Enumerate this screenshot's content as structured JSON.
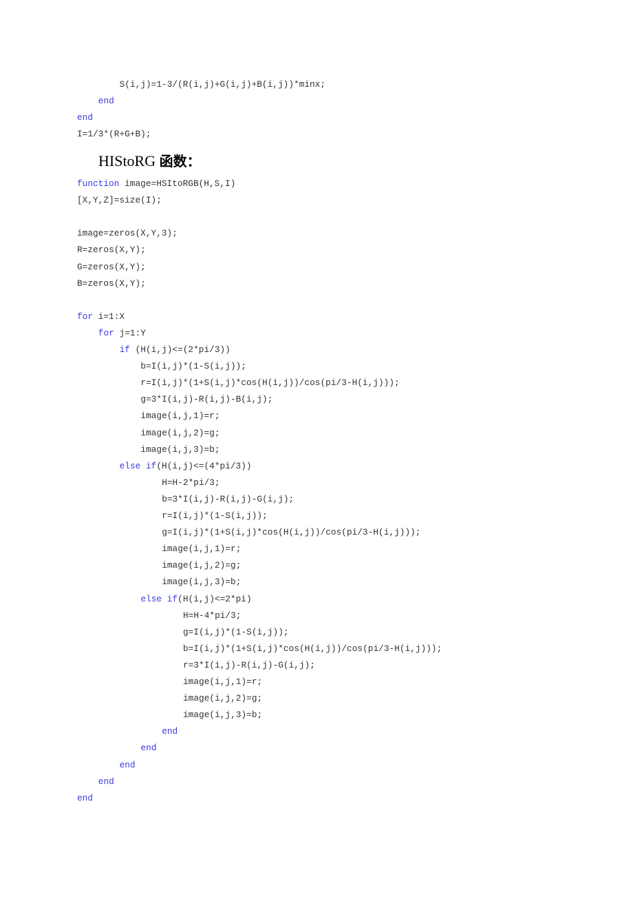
{
  "document": {
    "colors": {
      "keyword": "#3a3ae0",
      "code": "#333333",
      "heading": "#000000"
    },
    "pre_lines": [
      {
        "indent": 2,
        "kw": "",
        "text": "S(i,j)=1-3/(R(i,j)+G(i,j)+B(i,j))*minx;"
      },
      {
        "indent": 1,
        "kw": "end",
        "text": ""
      },
      {
        "indent": 0,
        "kw": "end",
        "text": ""
      },
      {
        "indent": 0,
        "kw": "",
        "text": "I=1/3*(R+G+B);"
      }
    ],
    "section_heading": {
      "latin": "HIStoRG",
      "cjk": "函数："
    },
    "code_lines": [
      {
        "indent": 0,
        "kw": "function",
        "text": " image=HSItoRGB(H,S,I)"
      },
      {
        "indent": 0,
        "kw": "",
        "text": "[X,Y,Z]=size(I);"
      },
      {
        "indent": 0,
        "kw": "",
        "text": ""
      },
      {
        "indent": 0,
        "kw": "",
        "text": "image=zeros(X,Y,3);"
      },
      {
        "indent": 0,
        "kw": "",
        "text": "R=zeros(X,Y);"
      },
      {
        "indent": 0,
        "kw": "",
        "text": "G=zeros(X,Y);"
      },
      {
        "indent": 0,
        "kw": "",
        "text": "B=zeros(X,Y);"
      },
      {
        "indent": 0,
        "kw": "",
        "text": ""
      },
      {
        "indent": 0,
        "kw": "for",
        "text": " i=1:X"
      },
      {
        "indent": 1,
        "kw": "for",
        "text": " j=1:Y"
      },
      {
        "indent": 2,
        "kw": "if",
        "text": " (H(i,j)<=(2*pi/3))"
      },
      {
        "indent": 3,
        "kw": "",
        "text": "b=I(i,j)*(1-S(i,j));"
      },
      {
        "indent": 3,
        "kw": "",
        "text": "r=I(i,j)*(1+S(i,j)*cos(H(i,j))/cos(pi/3-H(i,j)));"
      },
      {
        "indent": 3,
        "kw": "",
        "text": "g=3*I(i,j)-R(i,j)-B(i,j);"
      },
      {
        "indent": 3,
        "kw": "",
        "text": "image(i,j,1)=r;"
      },
      {
        "indent": 3,
        "kw": "",
        "text": "image(i,j,2)=g;"
      },
      {
        "indent": 3,
        "kw": "",
        "text": "image(i,j,3)=b;"
      },
      {
        "indent": 2,
        "kw": "else if",
        "text": "(H(i,j)<=(4*pi/3))"
      },
      {
        "indent": 4,
        "kw": "",
        "text": "H=H-2*pi/3;"
      },
      {
        "indent": 4,
        "kw": "",
        "text": "b=3*I(i,j)-R(i,j)-G(i,j);"
      },
      {
        "indent": 4,
        "kw": "",
        "text": "r=I(i,j)*(1-S(i,j));"
      },
      {
        "indent": 4,
        "kw": "",
        "text": "g=I(i,j)*(1+S(i,j)*cos(H(i,j))/cos(pi/3-H(i,j)));"
      },
      {
        "indent": 4,
        "kw": "",
        "text": "image(i,j,1)=r;"
      },
      {
        "indent": 4,
        "kw": "",
        "text": "image(i,j,2)=g;"
      },
      {
        "indent": 4,
        "kw": "",
        "text": "image(i,j,3)=b;"
      },
      {
        "indent": 3,
        "kw": "else if",
        "text": "(H(i,j)<=2*pi)"
      },
      {
        "indent": 5,
        "kw": "",
        "text": "H=H-4*pi/3;"
      },
      {
        "indent": 5,
        "kw": "",
        "text": "g=I(i,j)*(1-S(i,j));"
      },
      {
        "indent": 5,
        "kw": "",
        "text": "b=I(i,j)*(1+S(i,j)*cos(H(i,j))/cos(pi/3-H(i,j)));"
      },
      {
        "indent": 5,
        "kw": "",
        "text": "r=3*I(i,j)-R(i,j)-G(i,j);"
      },
      {
        "indent": 5,
        "kw": "",
        "text": "image(i,j,1)=r;"
      },
      {
        "indent": 5,
        "kw": "",
        "text": "image(i,j,2)=g;"
      },
      {
        "indent": 5,
        "kw": "",
        "text": "image(i,j,3)=b;"
      },
      {
        "indent": 4,
        "kw": "end",
        "text": ""
      },
      {
        "indent": 3,
        "kw": "end",
        "text": ""
      },
      {
        "indent": 2,
        "kw": "end",
        "text": ""
      },
      {
        "indent": 1,
        "kw": "end",
        "text": ""
      },
      {
        "indent": 0,
        "kw": "end",
        "text": ""
      }
    ]
  }
}
